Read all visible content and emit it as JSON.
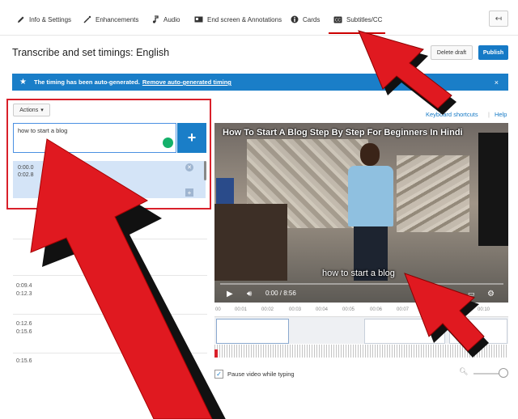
{
  "tabs": [
    {
      "label": "Info & Settings",
      "icon": "pencil-icon"
    },
    {
      "label": "Enhancements",
      "icon": "magic-wand-icon"
    },
    {
      "label": "Audio",
      "icon": "music-note-icon"
    },
    {
      "label": "End screen & Annotations",
      "icon": "end-screen-icon"
    },
    {
      "label": "Cards",
      "icon": "info-icon"
    },
    {
      "label": "Subtitles/CC",
      "icon": "cc-icon",
      "active": true
    }
  ],
  "back_label": "↤",
  "page": {
    "title": "Transcribe and set timings: English",
    "delete_draft": "Delete draft",
    "publish": "Publish"
  },
  "banner": {
    "text": "The timing has been auto-generated.",
    "link": "Remove auto-generated timing",
    "close": "×"
  },
  "actions_label": "Actions",
  "keyboard_shortcuts": "Keyboard shortcuts",
  "separator": "|",
  "help": "Help",
  "caption_input": {
    "value": "how to start a blog"
  },
  "add_label": "+",
  "captions": [
    {
      "start": "0:00.0",
      "end": "0:02.8",
      "selected": true
    },
    {
      "start": "0:09.4",
      "end": "0:12.3"
    },
    {
      "start": "0:12.6",
      "end": "0:15.6"
    },
    {
      "start": "0:15.6",
      "end": ""
    }
  ],
  "video": {
    "title": "How To Start A Blog Step By Step For Beginners In Hindi",
    "caption": "how to start a blog",
    "time": "0:00 / 8:56"
  },
  "timeline_ticks": [
    "00",
    "00:01",
    "00:02",
    "00:03",
    "00:04",
    "00:05",
    "00:06",
    "00:07",
    "00:08",
    "00:09",
    "00:10"
  ],
  "pause_while_typing": {
    "label": "Pause video while typing",
    "checked": true
  },
  "colors": {
    "accent": "#1a7ec8",
    "active_tab": "#cc0000",
    "annotation_red": "#d9202a"
  }
}
